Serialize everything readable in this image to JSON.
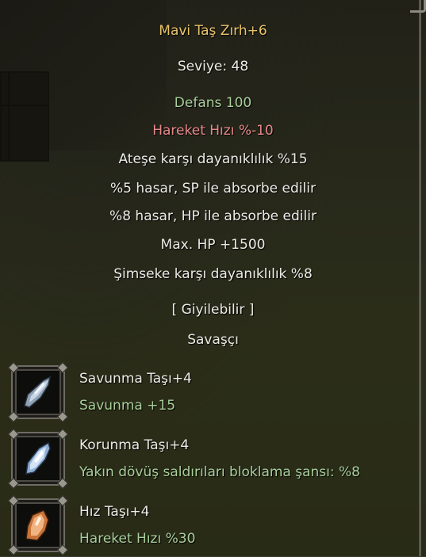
{
  "item": {
    "name": "Mavi Taş Zırh+6",
    "level_line": "Seviye: 48",
    "defense_line": "Defans 100",
    "speed_penalty_line": "Hareket Hızı %-10",
    "bonuses": [
      "Ateşe karşı dayanıklılık %15",
      "%5 hasar, SP ile absorbe edilir",
      "%8 hasar, HP ile absorbe edilir",
      "Max. HP +1500",
      "Şimseke karşı dayanıklılık %8"
    ],
    "wearable_line": "[ Giyilebilir ]",
    "class_line": "Savaşçı"
  },
  "sockets": [
    {
      "name": "Savunma Taşı+4",
      "effect": "Savunma +15",
      "icon": "blue-crystal-stone-icon"
    },
    {
      "name": "Korunma Taşı+4",
      "effect": "Yakın dövüş saldırıları bloklama şansı: %8",
      "icon": "blue-crystal-stone-icon"
    },
    {
      "name": "Hız Taşı+4",
      "effect": "Hareket Hızı %30",
      "icon": "orange-crystal-stone-icon"
    }
  ],
  "colors": {
    "title": "#e9c46a",
    "text": "#ecebe6",
    "bonus_green": "#a9cf9b",
    "penalty_red": "#e88a8a"
  }
}
